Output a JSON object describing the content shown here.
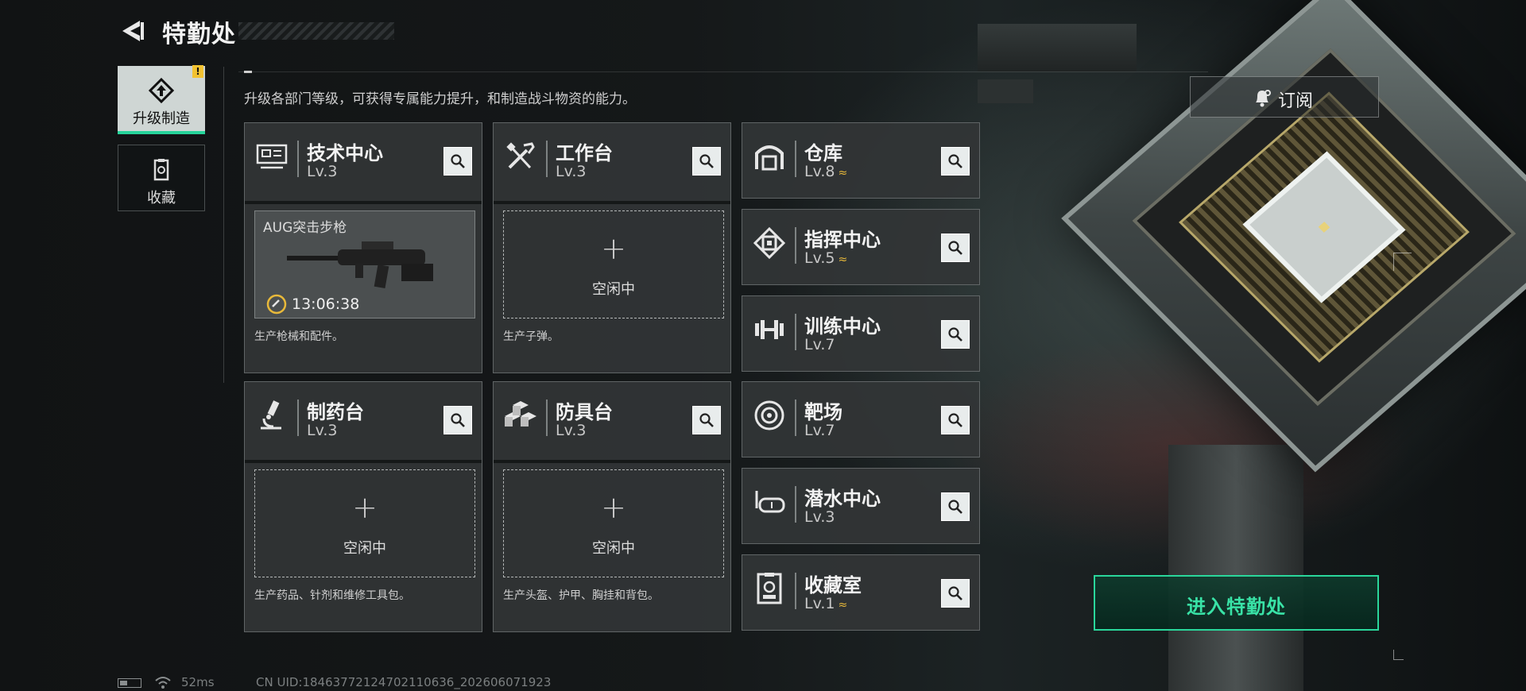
{
  "header": {
    "title": "特勤处"
  },
  "sidebar": {
    "items": [
      {
        "label": "升级制造",
        "icon": "upgrade-icon",
        "active": true
      },
      {
        "label": "收藏",
        "icon": "collection-icon",
        "active": false
      }
    ],
    "alert_badge": "!"
  },
  "description": "升级各部门等级，可获得专属能力提升，和制造战斗物资的能力。",
  "departments": {
    "tech": {
      "name": "技术中心",
      "level": "Lv.3",
      "icon": "monitor-icon",
      "slot": {
        "item": "AUG突击步枪",
        "timer": "13:06:38"
      },
      "note": "生产枪械和配件。"
    },
    "workbench": {
      "name": "工作台",
      "level": "Lv.3",
      "icon": "tools-icon",
      "slot": {
        "status": "空闲中"
      },
      "note": "生产子弹。"
    },
    "pharmacy": {
      "name": "制药台",
      "level": "Lv.3",
      "icon": "microscope-icon",
      "slot": {
        "status": "空闲中"
      },
      "note": "生产药品、针剂和维修工具包。"
    },
    "armor": {
      "name": "防具台",
      "level": "Lv.3",
      "icon": "armor-blocks-icon",
      "slot": {
        "status": "空闲中"
      },
      "note": "生产头盔、护甲、胸挂和背包。"
    },
    "warehouse": {
      "name": "仓库",
      "level": "Lv.8",
      "icon": "warehouse-icon",
      "upgradable": true
    },
    "command": {
      "name": "指挥中心",
      "level": "Lv.5",
      "icon": "chip-icon",
      "upgradable": true
    },
    "training": {
      "name": "训练中心",
      "level": "Lv.7",
      "icon": "dumbbell-icon",
      "upgradable": false
    },
    "range": {
      "name": "靶场",
      "level": "Lv.7",
      "icon": "target-icon",
      "upgradable": false
    },
    "diving": {
      "name": "潜水中心",
      "level": "Lv.3",
      "icon": "diving-mask-icon",
      "upgradable": false
    },
    "vault": {
      "name": "收藏室",
      "level": "Lv.1",
      "icon": "vault-icon",
      "upgradable": true
    }
  },
  "upgrade_marker": "≈",
  "subscribe_button": "订阅",
  "enter_button": "进入特勤处",
  "status_bar": {
    "ping": "52ms",
    "uid": "CN UID:18463772124702110636_202606071923"
  },
  "colors": {
    "accent": "#2ad79b",
    "upgrade": "#e8b93a",
    "alert": "#f2c231"
  }
}
